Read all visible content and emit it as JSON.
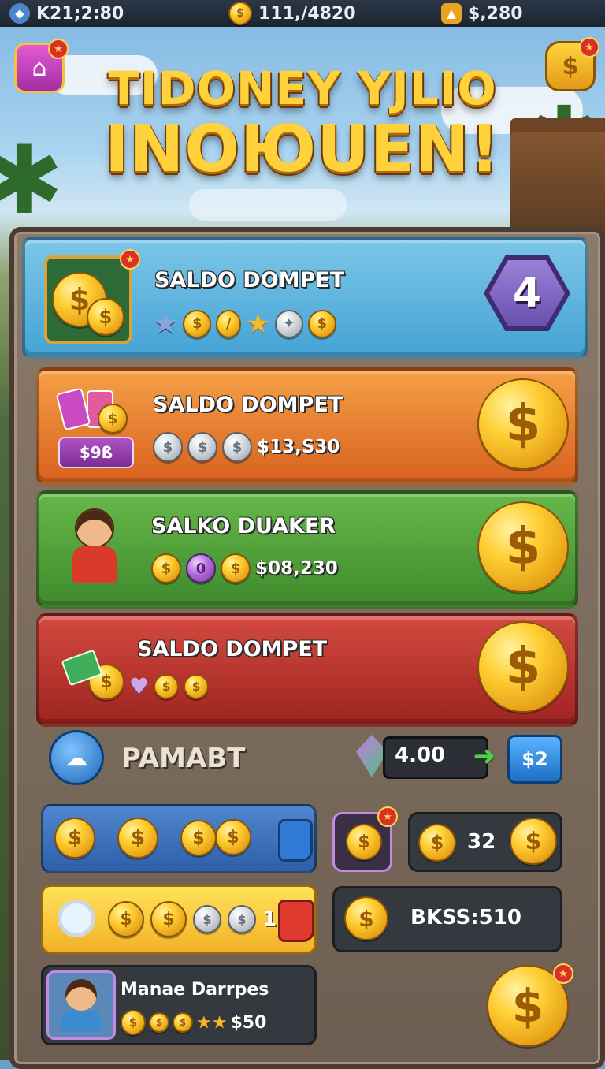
{
  "topbar": {
    "left_icon": "gem-icon",
    "left_value": "K21;2:80",
    "mid_icon": "coin-icon",
    "mid_value": "111,/4820",
    "right_icon": "gold-nugget-icon",
    "right_value": "$,280"
  },
  "title": {
    "line1": "TIDONEY YJLIO",
    "line2": "INOЮUEN!"
  },
  "rows": [
    {
      "label": "SALDO DOMPET",
      "level": "4",
      "color": "#58b3dc"
    },
    {
      "label": "SALDO DOMPET",
      "badge": "$9ß",
      "amount": "$13,S30",
      "color": "#ec7f2b"
    },
    {
      "label": "SALKO DUAKER",
      "amount": "$08,230",
      "color": "#4f9c3c"
    },
    {
      "label": "SALDO DOMPET",
      "color": "#c2332c"
    }
  ],
  "footer_row": {
    "label": "PAMABT",
    "value": "4.00",
    "button": "$2"
  },
  "panels": {
    "right_top_value": "32",
    "yellow_count": "1",
    "bkss_label": "BKSS:510",
    "profile_name": "Manae Darrpes",
    "profile_value": "$50"
  },
  "icons": {
    "home": "home-icon",
    "shop": "dollar-coin-icon",
    "search": "magnifier-icon"
  }
}
